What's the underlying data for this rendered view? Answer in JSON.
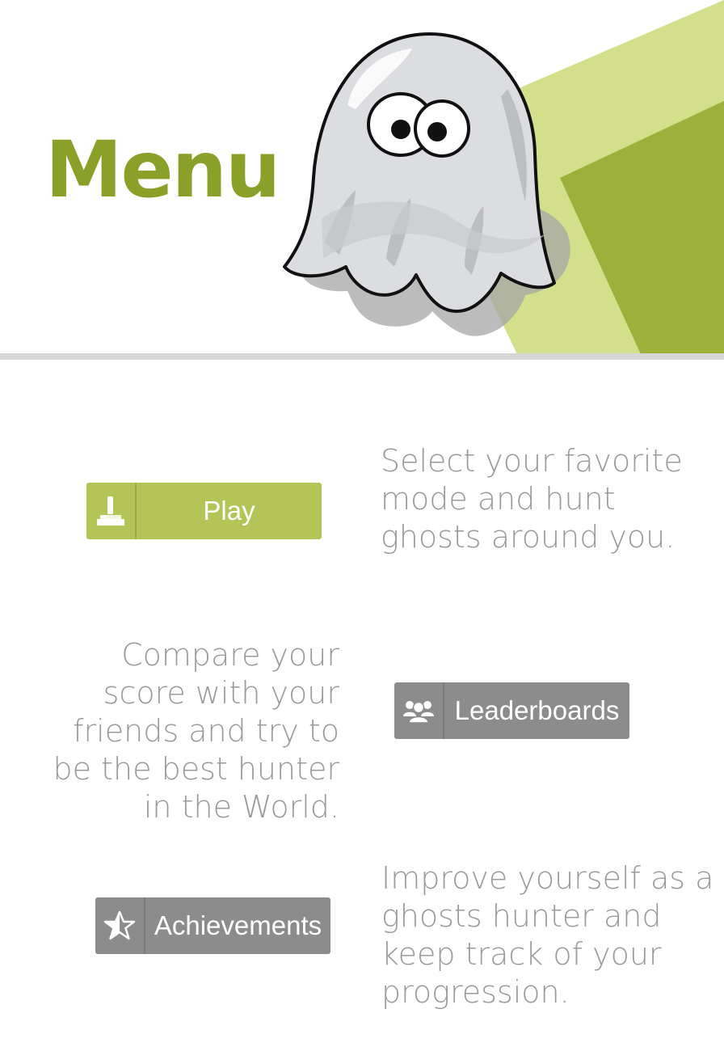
{
  "header": {
    "title": "Menu",
    "mascot_icon": "ghost-mascot-icon"
  },
  "sections": {
    "play": {
      "button_label": "Play",
      "icon": "joystick-icon",
      "description": "Select your favorite mode and hunt ghosts around you."
    },
    "leaderboards": {
      "button_label": "Leaderboards",
      "icon": "people-group-icon",
      "description": "Compare your score with your friends and try to be the best hunter in the World."
    },
    "achievements": {
      "button_label": "Achievements",
      "icon": "half-star-icon",
      "description": "Improve yourself as a ghosts hunter and keep track of your progression."
    }
  },
  "colors": {
    "brand_green": "#8aa028",
    "light_green": "#d3df8a",
    "dark_green": "#9cb03a",
    "play_button": "#b5c456",
    "gray_button": "#8c8c8c",
    "description_text": "#9a9a9a"
  }
}
